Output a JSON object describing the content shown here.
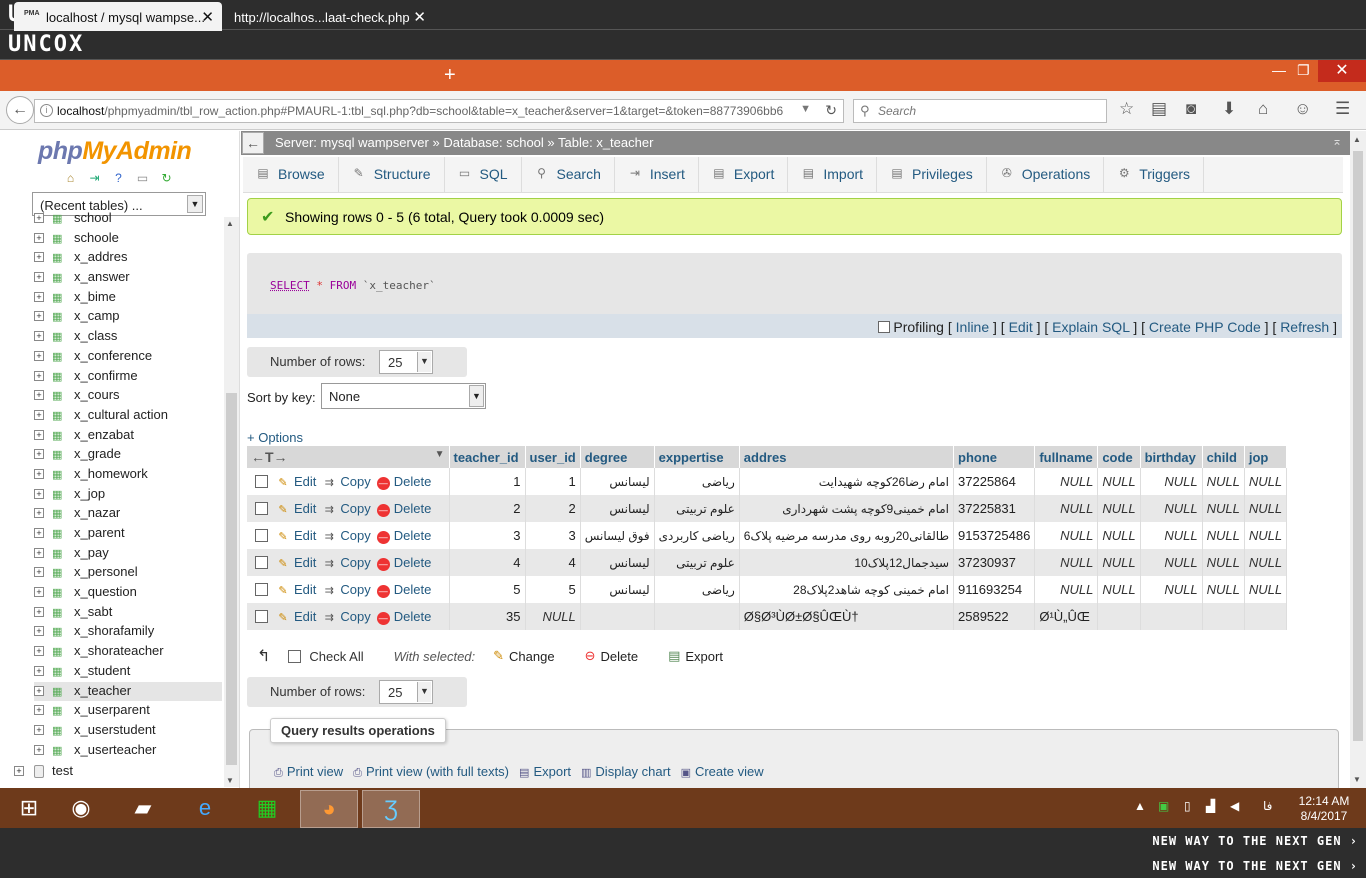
{
  "banner": {
    "top1": "UNCOX",
    "top2": "UNCOX",
    "bottom1": "NEW WAY TO THE NEXT GEN ›",
    "bottom2": "NEW WAY TO THE NEXT GEN ›"
  },
  "browser": {
    "tabs": [
      {
        "label": "localhost / mysql wampse...",
        "favicon": "PMA"
      },
      {
        "label": "http://localhos...laat-check.php"
      }
    ],
    "url_host": "localhost",
    "url_rest": "/phpmyadmin/tbl_row_action.php#PMAURL-1:tbl_sql.php?db=school&table=x_teacher&server=1&target=&token=88773906bb6",
    "search_placeholder": "Search"
  },
  "sidebar": {
    "logo_php": "php",
    "logo_admin": "MyAdmin",
    "recent_tables": "(Recent tables) ...",
    "tables": [
      "school",
      "schoole",
      "x_addres",
      "x_answer",
      "x_bime",
      "x_camp",
      "x_class",
      "x_conference",
      "x_confirme",
      "x_cours",
      "x_cultural action",
      "x_enzabat",
      "x_grade",
      "x_homework",
      "x_jop",
      "x_nazar",
      "x_parent",
      "x_pay",
      "x_personel",
      "x_question",
      "x_sabt",
      "x_shorafamily",
      "x_shorateacher",
      "x_student",
      "x_teacher",
      "x_userparent",
      "x_userstudent",
      "x_userteacher"
    ],
    "selected_table": "x_teacher",
    "other_db": "test"
  },
  "breadcrumb": {
    "server": "Server: mysql wampserver",
    "database": "Database: school",
    "table": "Table: x_teacher"
  },
  "menu": [
    "Browse",
    "Structure",
    "SQL",
    "Search",
    "Insert",
    "Export",
    "Import",
    "Privileges",
    "Operations",
    "Triggers"
  ],
  "success_msg": "Showing rows 0 - 5 (6 total, Query took 0.0009 sec)",
  "sql": {
    "select": "SELECT",
    "star": "*",
    "from": "FROM",
    "table": "`x_teacher`"
  },
  "sql_links": {
    "profiling": "Profiling",
    "inline": "Inline",
    "edit": "Edit",
    "explain": "Explain SQL",
    "php": "Create PHP Code",
    "refresh": "Refresh"
  },
  "number_of_rows_label": "Number of rows:",
  "number_of_rows": "25",
  "sort_label": "Sort by key:",
  "sort_value": "None",
  "options_label": "+ Options",
  "columns": [
    "teacher_id",
    "user_id",
    "degree",
    "exppertise",
    "addres",
    "phone",
    "fullname",
    "code",
    "birthday",
    "child",
    "jop"
  ],
  "row_actions": {
    "edit": "Edit",
    "copy": "Copy",
    "delete": "Delete"
  },
  "rows": [
    {
      "teacher_id": "1",
      "user_id": "1",
      "degree": "لیسانس",
      "exppertise": "ریاضی",
      "addres": "امام رضا26کوچه شهیدایت",
      "phone": "37225864",
      "fullname": "NULL",
      "code": "NULL",
      "birthday": "NULL",
      "child": "NULL",
      "jop": "NULL"
    },
    {
      "teacher_id": "2",
      "user_id": "2",
      "degree": "لیسانس",
      "exppertise": "علوم تربیتی",
      "addres": "امام خمینی9کوچه پشت شهرداری",
      "phone": "37225831",
      "fullname": "NULL",
      "code": "NULL",
      "birthday": "NULL",
      "child": "NULL",
      "jop": "NULL"
    },
    {
      "teacher_id": "3",
      "user_id": "3",
      "degree": "فوق لیسانس",
      "exppertise": "ریاضی کاربردی",
      "addres": "طالقانی20روبه روی مدرسه مرضیه پلاک6",
      "phone": "9153725486",
      "fullname": "NULL",
      "code": "NULL",
      "birthday": "NULL",
      "child": "NULL",
      "jop": "NULL"
    },
    {
      "teacher_id": "4",
      "user_id": "4",
      "degree": "لیسانس",
      "exppertise": "علوم تربیتی",
      "addres": "سیدجمال12پلاک10",
      "phone": "37230937",
      "fullname": "NULL",
      "code": "NULL",
      "birthday": "NULL",
      "child": "NULL",
      "jop": "NULL"
    },
    {
      "teacher_id": "5",
      "user_id": "5",
      "degree": "لیسانس",
      "exppertise": "ریاضی",
      "addres": "امام خمینی کوچه شاهد2پلاک28",
      "phone": "911693254",
      "fullname": "NULL",
      "code": "NULL",
      "birthday": "NULL",
      "child": "NULL",
      "jop": "NULL"
    },
    {
      "teacher_id": "35",
      "user_id": "NULL",
      "degree": "",
      "exppertise": "",
      "addres": "Ø§Ø³ÙØ±Ø§ÛŒÙ†",
      "phone": "2589522",
      "fullname": "Ø¹Ù„ÛŒ",
      "code": "",
      "birthday": "",
      "child": "",
      "jop": ""
    }
  ],
  "check_all": "Check All",
  "with_selected": "With selected:",
  "bulk": {
    "change": "Change",
    "delete": "Delete",
    "export": "Export"
  },
  "qro": {
    "title": "Query results operations",
    "links": [
      "Print view",
      "Print view (with full texts)",
      "Export",
      "Display chart",
      "Create view"
    ]
  },
  "clock": {
    "time": "12:14 AM",
    "date": "8/4/2017",
    "lang": "فا"
  }
}
